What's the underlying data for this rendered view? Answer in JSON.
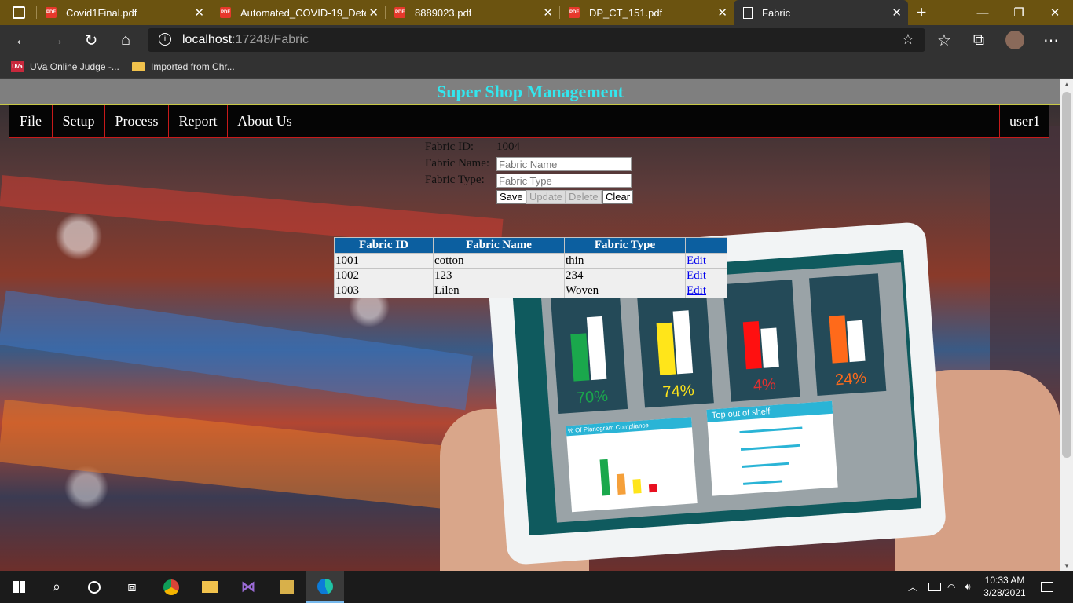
{
  "browser": {
    "tabs": [
      {
        "title": "Covid1Final.pdf",
        "icon": "pdf-icon",
        "active": false
      },
      {
        "title": "Automated_COVID-19_Detect",
        "icon": "pdf-icon",
        "active": false
      },
      {
        "title": "8889023.pdf",
        "icon": "pdf-icon",
        "active": false
      },
      {
        "title": "DP_CT_151.pdf",
        "icon": "pdf-icon",
        "active": false
      },
      {
        "title": "Fabric",
        "icon": "page-icon",
        "active": true
      }
    ],
    "pdf_badge": "PDF",
    "new_tab": "+",
    "address": {
      "host": "localhost",
      "rest": ":17248/Fabric"
    },
    "favorites": [
      {
        "label": "UVa Online Judge -...",
        "badge": "UVa"
      },
      {
        "label": "Imported from Chr..."
      }
    ]
  },
  "page": {
    "title": "Super Shop Management",
    "menu": [
      "File",
      "Setup",
      "Process",
      "Report",
      "About Us"
    ],
    "user": "user1",
    "form": {
      "id_label": "Fabric ID:",
      "id_value": "1004",
      "name_label": "Fabric Name:",
      "name_placeholder": "Fabric Name",
      "type_label": "Fabric Type:",
      "type_placeholder": "Fabric Type",
      "buttons": {
        "save": "Save",
        "update": "Update",
        "delete": "Delete",
        "clear": "Clear"
      }
    },
    "table": {
      "headers": [
        "Fabric ID",
        "Fabric Name",
        "Fabric Type",
        ""
      ],
      "rows": [
        {
          "id": "1001",
          "name": "cotton",
          "type": "thin",
          "action": "Edit"
        },
        {
          "id": "1002",
          "name": "123",
          "type": "234",
          "action": "Edit"
        },
        {
          "id": "1003",
          "name": "Lilen",
          "type": "Woven",
          "action": "Edit"
        }
      ]
    },
    "background_tablet": {
      "percentages": [
        "70%",
        "74%",
        "4%",
        "24%"
      ],
      "chart_title": "% Of Planogram Compliance",
      "list_title": "Top out of shelf"
    }
  },
  "taskbar": {
    "time": "10:33 AM",
    "date": "3/28/2021"
  },
  "colors": {
    "title": "#33e6ee",
    "menu_border": "#c71a1a",
    "table_header": "#0c5fa0",
    "tabbar": "#6b5310"
  }
}
